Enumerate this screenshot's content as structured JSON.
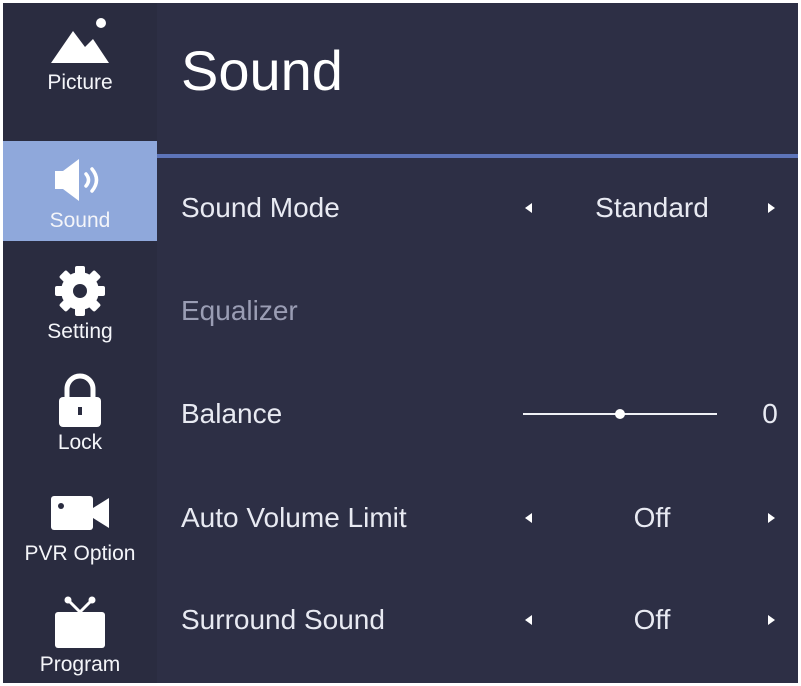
{
  "sidebar": {
    "items": [
      {
        "label": "Picture",
        "icon": "picture-icon",
        "active": false
      },
      {
        "label": "Sound",
        "icon": "speaker-icon",
        "active": true
      },
      {
        "label": "Setting",
        "icon": "gear-icon",
        "active": false
      },
      {
        "label": "Lock",
        "icon": "lock-icon",
        "active": false
      },
      {
        "label": "PVR Option",
        "icon": "camera-icon",
        "active": false
      },
      {
        "label": "Program",
        "icon": "tv-icon",
        "active": false
      }
    ]
  },
  "main": {
    "title": "Sound",
    "rows": {
      "sound_mode": {
        "label": "Sound Mode",
        "value": "Standard"
      },
      "equalizer": {
        "label": "Equalizer"
      },
      "balance": {
        "label": "Balance",
        "value": "0",
        "slider_fraction": 0.5
      },
      "auto_volume_limit": {
        "label": "Auto Volume Limit",
        "value": "Off"
      },
      "surround_sound": {
        "label": "Surround Sound",
        "value": "Off"
      }
    }
  },
  "colors": {
    "background": "#2d2f45",
    "sidebar": "#2a2c40",
    "active_item": "#8fa8db",
    "divider": "#5d74b8",
    "text": "#e8eaf2",
    "dim_text": "#9a9db4"
  }
}
